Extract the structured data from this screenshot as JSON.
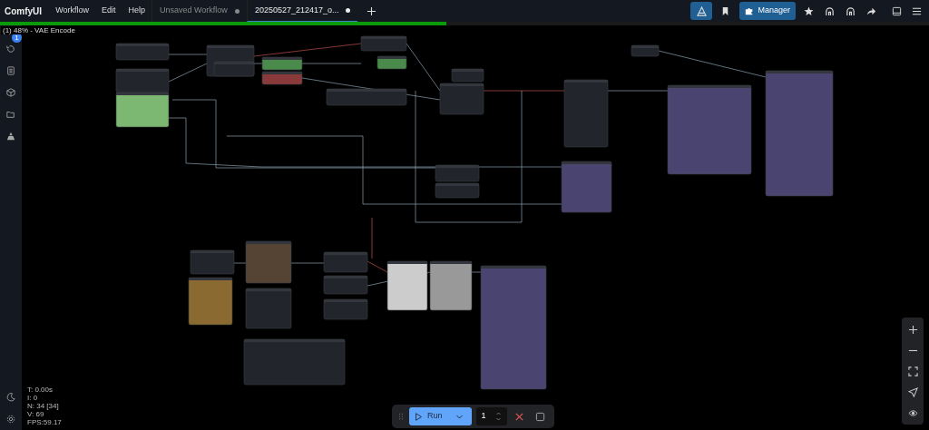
{
  "menu_bar": {
    "logo": "ComfyUI",
    "menus": [
      "Workflow",
      "Edit",
      "Help"
    ],
    "tabs": [
      {
        "label": "Unsaved Workflow",
        "selected": false,
        "modified": true
      },
      {
        "label": "20250527_212417_o...",
        "selected": true,
        "modified": true
      }
    ],
    "manager": "Manager"
  },
  "progress": {
    "level": 0.48,
    "label": "(1) 48% - VAE Encode"
  },
  "sidebar": {
    "queue_badge": "1"
  },
  "stats": [
    "T: 0.00s",
    "I: 0",
    "N: 34 [34]",
    "V: 69",
    "FPS:59.17"
  ],
  "run_bar": {
    "run": "Run",
    "batch_count": "1"
  }
}
